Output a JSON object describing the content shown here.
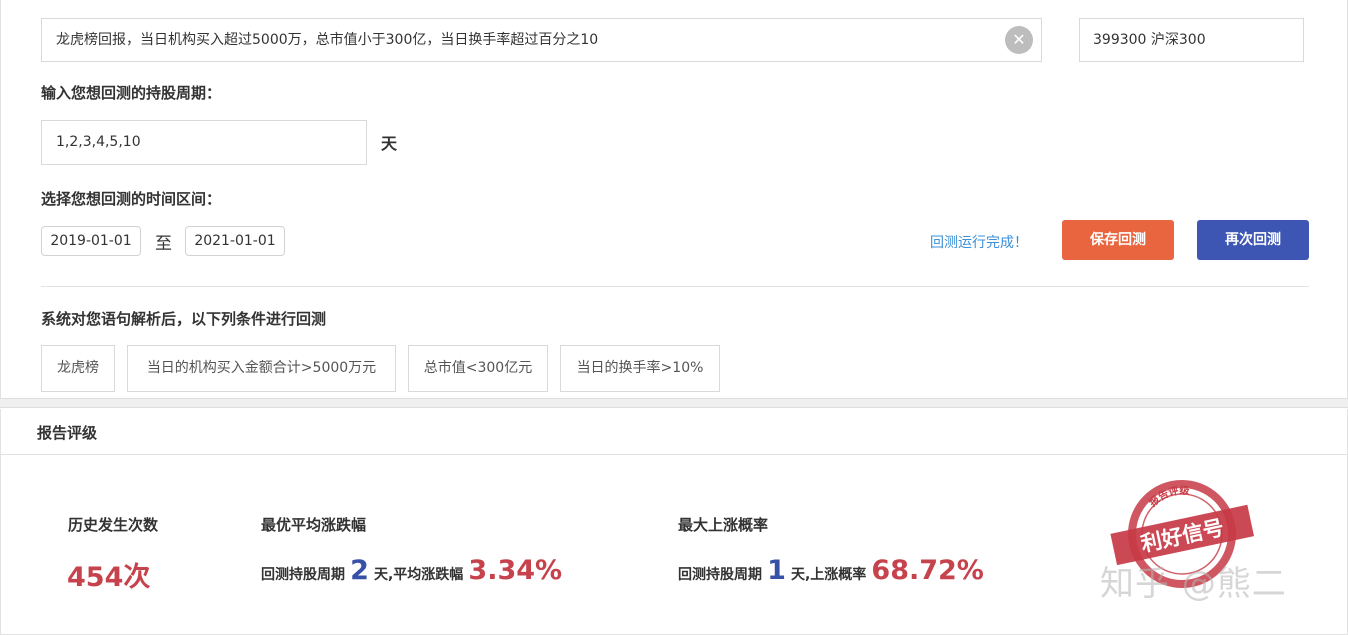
{
  "query": {
    "text": "龙虎榜回报，当日机构买入超过5000万，总市值小于300亿，当日换手率超过百分之10",
    "clear_icon": "close-circle-icon"
  },
  "index": {
    "value": "399300 沪深300"
  },
  "holding_period": {
    "label": "输入您想回测的持股周期：",
    "value": "1,2,3,4,5,10",
    "unit": "天"
  },
  "time_range": {
    "label": "选择您想回测的时间区间：",
    "start": "2019-01-01",
    "to": "至",
    "end": "2021-01-01"
  },
  "status": {
    "text": "回测运行完成！"
  },
  "buttons": {
    "save": "保存回测",
    "rerun": "再次回测"
  },
  "conditions": {
    "title": "系统对您语句解析后，以下列条件进行回测",
    "items": [
      "龙虎榜",
      "当日的机构买入金额合计>5000万元",
      "总市值<300亿元",
      "当日的换手率>10%"
    ]
  },
  "report": {
    "title": "报告评级",
    "occurrences": {
      "label": "历史发生次数",
      "value": "454次"
    },
    "best_avg": {
      "label": "最优平均涨跌幅",
      "prefix": "回测持股周期",
      "period": "2",
      "middle": "天,平均涨跌幅",
      "value": "3.34%"
    },
    "max_prob": {
      "label": "最大上涨概率",
      "prefix": "回测持股周期",
      "period": "1",
      "middle": "天,上涨概率",
      "value": "68.72%"
    },
    "seal": {
      "ring_text": "报告评级",
      "main_text": "利好信号",
      "color": "#c73a45"
    }
  },
  "watermark": "知乎 @熊二"
}
